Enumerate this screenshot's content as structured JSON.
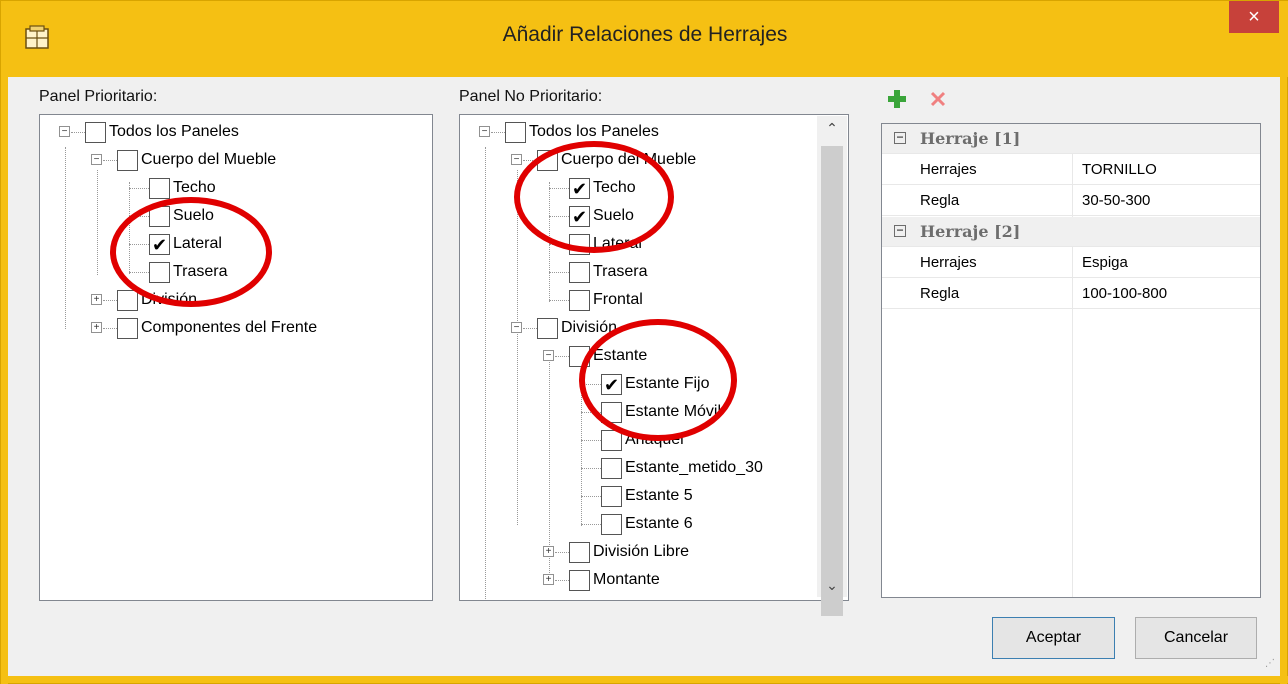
{
  "window": {
    "title": "Añadir Relaciones de Herrajes",
    "close_glyph": "×"
  },
  "left_panel": {
    "label": "Panel Prioritario:",
    "nodes": [
      {
        "label": "Todos los Paneles",
        "checked": false
      },
      {
        "label": "Cuerpo del Mueble",
        "checked": false
      },
      {
        "label": "Techo",
        "checked": false
      },
      {
        "label": "Suelo",
        "checked": false
      },
      {
        "label": "Lateral",
        "checked": true
      },
      {
        "label": "Trasera",
        "checked": false
      },
      {
        "label": "División",
        "checked": false
      },
      {
        "label": "Componentes del Frente",
        "checked": false
      }
    ]
  },
  "middle_panel": {
    "label": "Panel No Prioritario:",
    "nodes": [
      {
        "label": "Todos los Paneles",
        "checked": false
      },
      {
        "label": "Cuerpo del Mueble",
        "checked": false
      },
      {
        "label": "Techo",
        "checked": true
      },
      {
        "label": "Suelo",
        "checked": true
      },
      {
        "label": "Lateral",
        "checked": false
      },
      {
        "label": "Trasera",
        "checked": false
      },
      {
        "label": "Frontal",
        "checked": false
      },
      {
        "label": "División",
        "checked": false
      },
      {
        "label": "Estante",
        "checked": false
      },
      {
        "label": "Estante Fijo",
        "checked": true
      },
      {
        "label": "Estante Móvil",
        "checked": false
      },
      {
        "label": "Anaquel",
        "checked": false
      },
      {
        "label": "Estante_metido_30",
        "checked": false
      },
      {
        "label": "Estante 5",
        "checked": false
      },
      {
        "label": "Estante 6",
        "checked": false
      },
      {
        "label": "División Libre",
        "checked": false
      },
      {
        "label": "Montante",
        "checked": false
      }
    ]
  },
  "toolbar": {
    "add_icon": "plus-icon",
    "delete_icon": "x-icon",
    "add_color": "#3aa53a",
    "delete_color": "#f08080"
  },
  "properties": {
    "categories": [
      {
        "title": "Herraje [1]",
        "rows": [
          {
            "key": "Herrajes",
            "value": "TORNILLO"
          },
          {
            "key": "Regla",
            "value": "30-50-300"
          }
        ]
      },
      {
        "title": "Herraje [2]",
        "rows": [
          {
            "key": "Herrajes",
            "value": "Espiga"
          },
          {
            "key": "Regla",
            "value": "100-100-800"
          }
        ]
      }
    ]
  },
  "buttons": {
    "accept": "Aceptar",
    "cancel": "Cancelar"
  },
  "colors": {
    "title_bar": "#f5c013",
    "close_button": "#c7413a",
    "annotation": "#e00000"
  }
}
